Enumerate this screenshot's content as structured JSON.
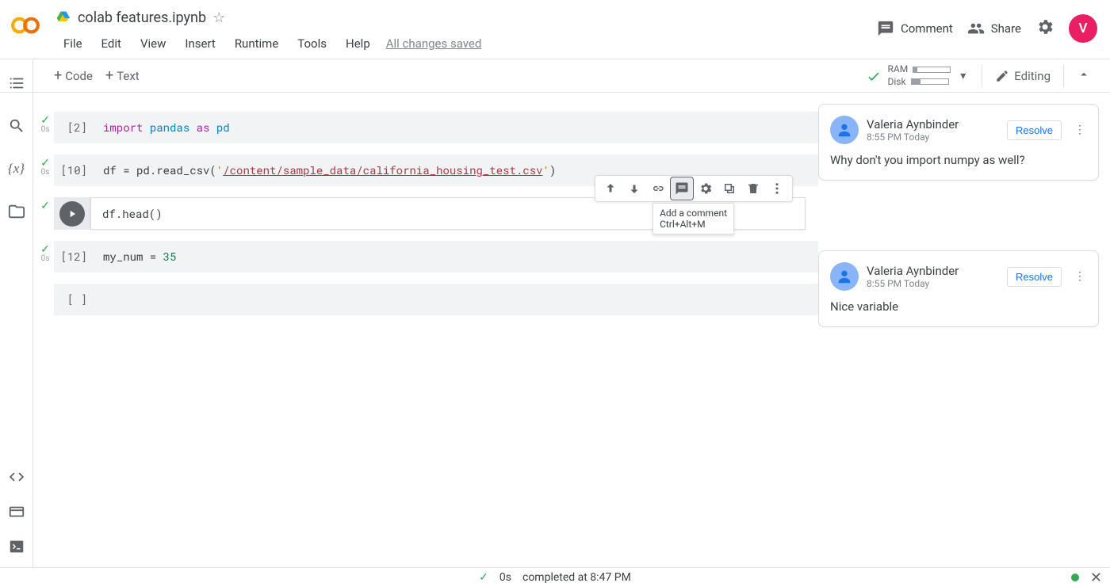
{
  "header": {
    "title": "colab features.ipynb",
    "menus": [
      "File",
      "Edit",
      "View",
      "Insert",
      "Runtime",
      "Tools",
      "Help"
    ],
    "save_status": "All changes saved",
    "comment_label": "Comment",
    "share_label": "Share",
    "avatar_letter": "V"
  },
  "toolbar": {
    "code_label": "Code",
    "text_label": "Text",
    "ram_label": "RAM",
    "disk_label": "Disk",
    "editing_label": "Editing"
  },
  "cells": [
    {
      "prompt": "[2]",
      "time": "0s",
      "check": true
    },
    {
      "prompt": "[10]",
      "time": "0s",
      "check": true
    },
    {
      "prompt": "",
      "time": "",
      "check": true,
      "active": true
    },
    {
      "prompt": "[12]",
      "time": "0s",
      "check": true
    },
    {
      "prompt": "[ ]",
      "time": "",
      "check": false
    }
  ],
  "code": {
    "c0_import": "import",
    "c0_pandas": "pandas",
    "c0_as": "as",
    "c0_pd": "pd",
    "c1_pre": "df = pd.read_csv(",
    "c1_q1": "'",
    "c1_path": "/content/sample_data/california_housing_test.csv",
    "c1_q2": "'",
    "c1_post": ")",
    "c2": "df.head()",
    "c3_pre": "my_num = ",
    "c3_num": "35"
  },
  "cell_toolbar": {
    "tooltip": "Add a comment\nCtrl+Alt+M"
  },
  "comments": [
    {
      "author": "Valeria Aynbinder",
      "time": "8:55 PM Today",
      "body": "Why don't you import numpy as well?",
      "resolve": "Resolve"
    },
    {
      "author": "Valeria Aynbinder",
      "time": "8:55 PM Today",
      "body": "Nice variable",
      "resolve": "Resolve"
    }
  ],
  "statusbar": {
    "duration": "0s",
    "message": "completed at 8:47 PM"
  }
}
